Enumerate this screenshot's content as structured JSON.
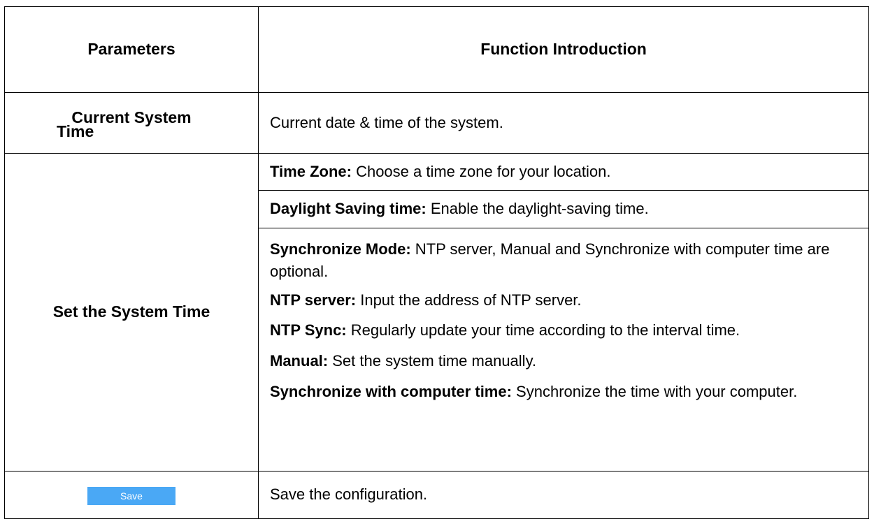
{
  "table": {
    "headers": {
      "parameters": "Parameters",
      "function": "Function Introduction"
    },
    "current_system_time": {
      "param_line1": "Current System",
      "param_line2": "Time",
      "description": "Current date & time of the system."
    },
    "set_system_time": {
      "param": "Set the System Time",
      "items": [
        {
          "term": "Time Zone:",
          "text": " Choose a time zone for your location."
        },
        {
          "term": "Daylight Saving time:",
          "text": " Enable the daylight-saving time."
        },
        {
          "term": "Synchronize Mode:",
          "text": " NTP server, Manual and Synchronize with computer time are optional."
        },
        {
          "term": "NTP server:",
          "text": " Input the address of NTP server."
        },
        {
          "term": "NTP Sync:",
          "text": " Regularly update your time according to the interval time."
        },
        {
          "term": "Manual:",
          "text": " Set the system time manually."
        },
        {
          "term": "Synchronize with computer time:",
          "text": " Synchronize the time with your computer."
        }
      ]
    },
    "save_row": {
      "button_label": "Save",
      "description": "Save the configuration."
    }
  }
}
